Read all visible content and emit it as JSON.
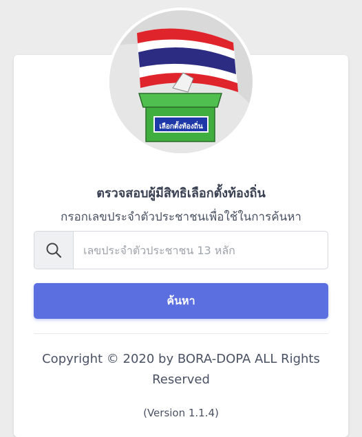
{
  "header": {
    "logo_badge_text": "เลือกตั้งท้องถิ่น"
  },
  "main": {
    "title": "ตรวจสอบผู้มีสิทธิเลือกตั้งท้องถิ่น",
    "subtitle": "กรอกเลขประจำตัวประชาชนเพื่อใช้ในการค้นหา",
    "search": {
      "placeholder": "เลขประจำตัวประชาชน 13 หลัก",
      "value": "",
      "icon": "search-icon"
    },
    "search_button_label": "ค้นหา"
  },
  "footer": {
    "copyright": "Copyright © 2020 by BORA-DOPA ALL Rights Reserved",
    "version": "(Version 1.1.4)"
  },
  "colors": {
    "accent": "#5b6fe0",
    "flag_red": "#e0242c",
    "flag_blue": "#2b2c82",
    "ballot_box_green": "#3fae3f"
  }
}
